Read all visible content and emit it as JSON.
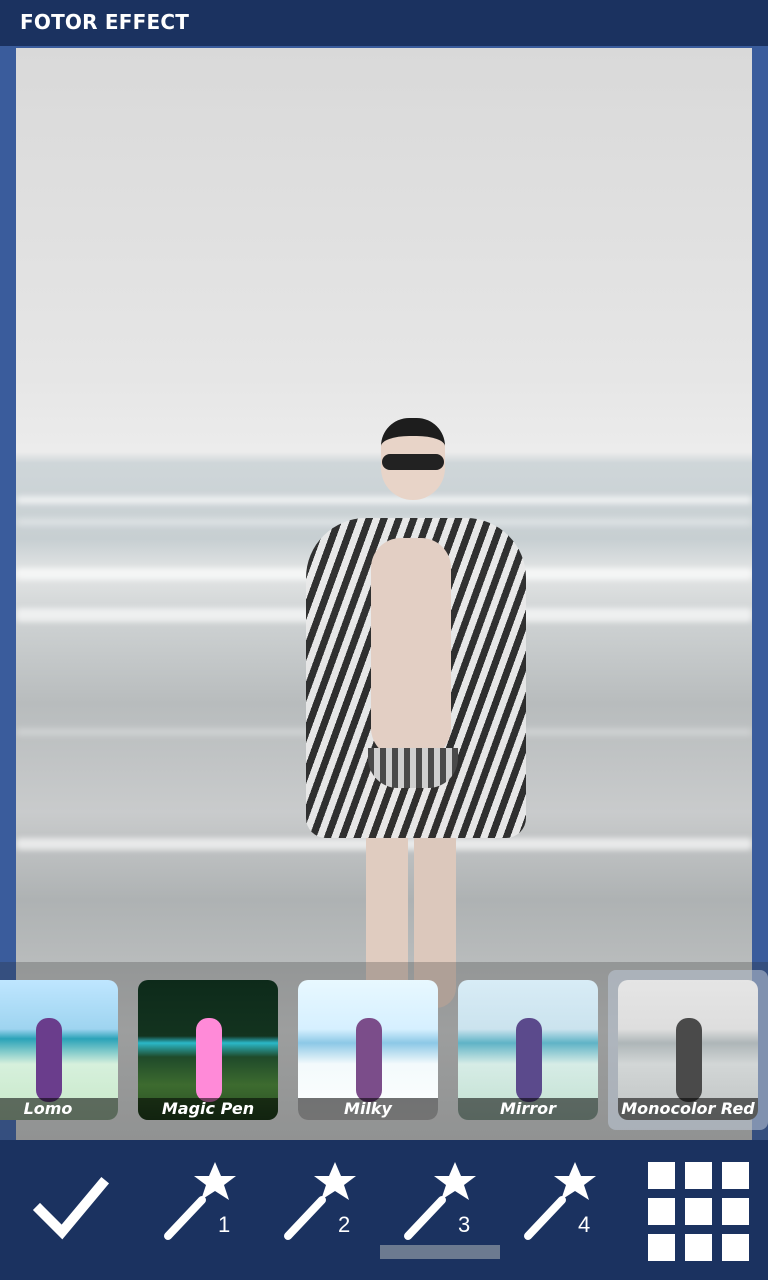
{
  "app": {
    "title": "FOTOR EFFECT"
  },
  "filters": [
    {
      "label": "Lomo",
      "selected": false
    },
    {
      "label": "Magic Pen",
      "selected": false
    },
    {
      "label": "Milky",
      "selected": false
    },
    {
      "label": "Mirror",
      "selected": false
    },
    {
      "label": "Monocolor Red",
      "selected": true
    }
  ],
  "toolbar": {
    "confirm_icon": "checkmark-icon",
    "effect_slots": [
      {
        "icon": "magic-wand-icon",
        "number": "1"
      },
      {
        "icon": "magic-wand-icon",
        "number": "2"
      },
      {
        "icon": "magic-wand-icon",
        "number": "3",
        "active": true
      },
      {
        "icon": "magic-wand-icon",
        "number": "4"
      }
    ],
    "grid_icon": "grid-icon"
  },
  "colors": {
    "header_bg": "#1b3260",
    "frame": "#3a5c9c",
    "toolbar_bg": "#1b3260"
  }
}
